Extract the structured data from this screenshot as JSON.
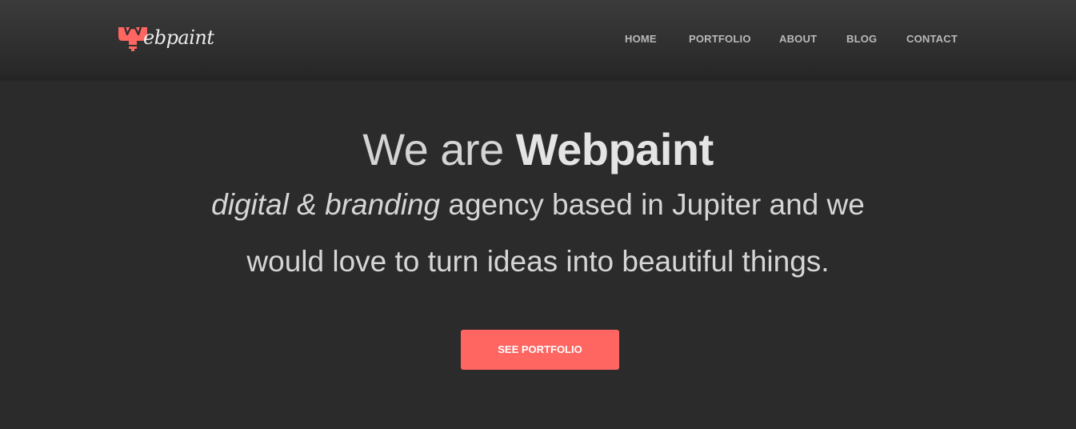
{
  "brand": {
    "logo_text": "ebpaint",
    "accent_color": "#ff6561",
    "logo_icon": "paint-brush-w-icon"
  },
  "nav": {
    "items": [
      {
        "label": "HOME"
      },
      {
        "label": "PORTFOLIO"
      },
      {
        "label": "ABOUT"
      },
      {
        "label": "BLOG"
      },
      {
        "label": "CONTACT"
      }
    ]
  },
  "hero": {
    "headline_prefix": "We are ",
    "headline_brand": "Webpaint",
    "line1_em1": "digital",
    "line1_amp": " & ",
    "line1_em2": "branding",
    "line1_rest": " agency based in Jupiter and we",
    "line2": "would love to turn ideas into beautiful things.",
    "cta_label": "SEE PORTFOLIO"
  }
}
